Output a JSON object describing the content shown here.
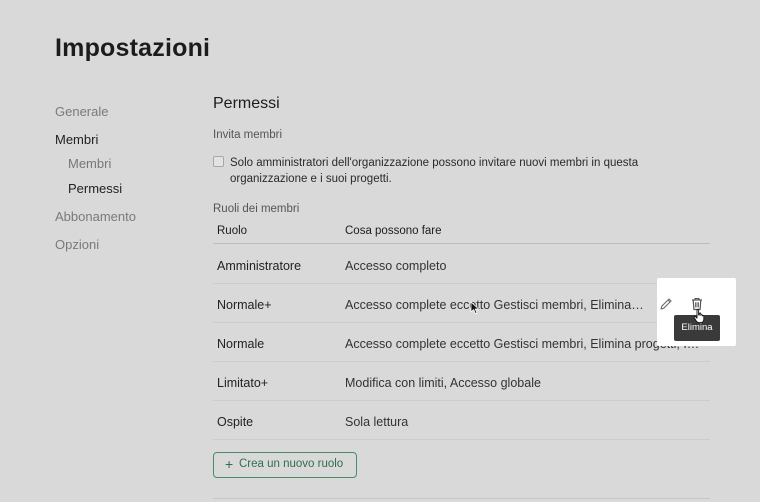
{
  "page": {
    "title": "Impostazioni"
  },
  "sidebar": {
    "items": [
      {
        "label": "Generale"
      },
      {
        "label": "Membri"
      },
      {
        "label": "Membri"
      },
      {
        "label": "Permessi"
      },
      {
        "label": "Abbonamento"
      },
      {
        "label": "Opzioni"
      }
    ],
    "active": "Permessi"
  },
  "permissions": {
    "title": "Permessi",
    "invite_label": "Invita membri",
    "invite_checkbox": {
      "checked": false,
      "text": "Solo amministratori dell'organizzazione possono invitare nuovi membri in questa organizzazione e i suoi progetti."
    },
    "roles_label": "Ruoli dei membri",
    "table": {
      "headers": [
        "Ruolo",
        "Cosa possono fare"
      ],
      "rows": [
        {
          "role": "Amministratore",
          "description": "Accesso completo"
        },
        {
          "role": "Normale+",
          "description": "Accesso complete eccetto Gestisci membri, Elimina progetti, Impostazioni organizzazione"
        },
        {
          "role": "Normale",
          "description": "Accesso complete eccetto Gestisci membri, Elimina progetti, Impostazioni organizzazione"
        },
        {
          "role": "Limitato+",
          "description": "Modifica con limiti, Accesso globale"
        },
        {
          "role": "Ospite",
          "description": "Sola lettura"
        }
      ]
    },
    "add_role_label": "Crea un nuovo ruolo"
  },
  "row_actions": {
    "edit_icon": "pencil-icon",
    "delete_icon": "trash-icon",
    "tooltip": "Elimina"
  },
  "colors": {
    "background": "#d9d9d9",
    "accent_green": "#2f6f4c",
    "tooltip_bg": "#3a3a3a"
  }
}
